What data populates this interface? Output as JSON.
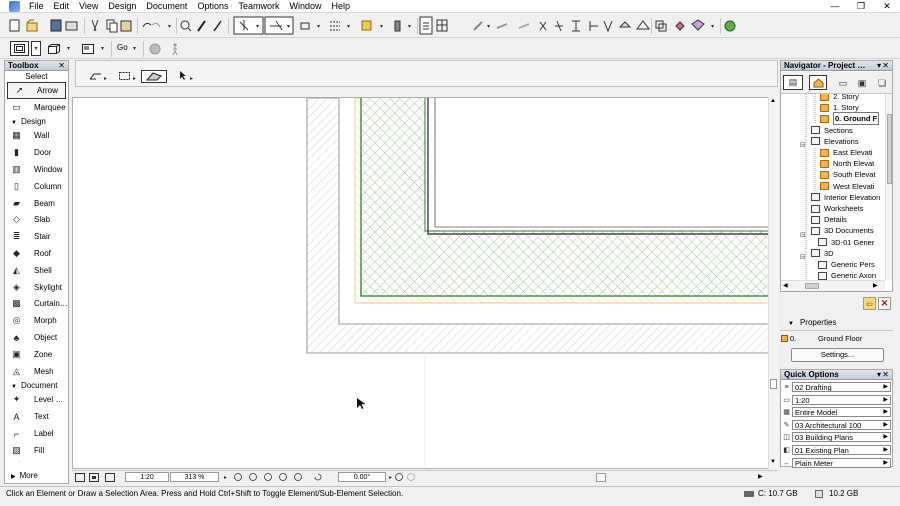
{
  "menubar": {
    "items": [
      "File",
      "Edit",
      "View",
      "Design",
      "Document",
      "Options",
      "Teamwork",
      "Window",
      "Help"
    ]
  },
  "window_controls": {
    "minimize": "—",
    "restore": "❐",
    "close": "✕"
  },
  "toolbar": {
    "go_label": "Go"
  },
  "toolbox": {
    "title": "Toolbox",
    "select_label": "Select",
    "select_tools": [
      {
        "label": "Arrow",
        "icon": "arrow-pointer-icon"
      },
      {
        "label": "Marquee",
        "icon": "marquee-icon"
      }
    ],
    "design_group": "Design",
    "design_tools": [
      {
        "label": "Wall",
        "icon": "wall-icon"
      },
      {
        "label": "Door",
        "icon": "door-icon"
      },
      {
        "label": "Window",
        "icon": "window-icon"
      },
      {
        "label": "Column",
        "icon": "column-icon"
      },
      {
        "label": "Beam",
        "icon": "beam-icon"
      },
      {
        "label": "Slab",
        "icon": "slab-icon"
      },
      {
        "label": "Stair",
        "icon": "stair-icon"
      },
      {
        "label": "Roof",
        "icon": "roof-icon"
      },
      {
        "label": "Shell",
        "icon": "shell-icon"
      },
      {
        "label": "Skylight",
        "icon": "skylight-icon"
      },
      {
        "label": "Curtain…",
        "icon": "curtain-wall-icon"
      },
      {
        "label": "Morph",
        "icon": "morph-icon"
      },
      {
        "label": "Object",
        "icon": "object-icon"
      },
      {
        "label": "Zone",
        "icon": "zone-icon"
      },
      {
        "label": "Mesh",
        "icon": "mesh-icon"
      }
    ],
    "document_group": "Document",
    "document_tools": [
      {
        "label": "Level …",
        "icon": "level-dimension-icon"
      },
      {
        "label": "Text",
        "icon": "text-icon"
      },
      {
        "label": "Label",
        "icon": "label-icon"
      },
      {
        "label": "Fill",
        "icon": "fill-icon"
      },
      {
        "label": "Line",
        "icon": "line-icon"
      }
    ],
    "more_label": "More"
  },
  "bottom_bar": {
    "scale": "1:20",
    "zoom": "313 %",
    "angle": "0.00°"
  },
  "status": {
    "message": "Click an Element or Draw a Selection Area. Press and Hold Ctrl+Shift to Toggle Element/Sub-Element Selection.",
    "disk_c": "C: 10.7 GB",
    "memory": "10.2 GB"
  },
  "navigator": {
    "title": "Navigator - Project …",
    "items": [
      {
        "label": "2. Story",
        "indent": 3,
        "icon": "house",
        "bold": false
      },
      {
        "label": "1. Story",
        "indent": 3,
        "icon": "house",
        "bold": false
      },
      {
        "label": "0. Ground F",
        "indent": 3,
        "icon": "house",
        "bold": true
      },
      {
        "label": "Sections",
        "indent": 1,
        "icon": "doc",
        "bold": false
      },
      {
        "label": "Elevations",
        "indent": 1,
        "icon": "doc",
        "bold": false
      },
      {
        "label": "East Elevati",
        "indent": 3,
        "icon": "house",
        "bold": false
      },
      {
        "label": "North Elevat",
        "indent": 3,
        "icon": "house",
        "bold": false
      },
      {
        "label": "South Elevat",
        "indent": 3,
        "icon": "house",
        "bold": false
      },
      {
        "label": "West Elevati",
        "indent": 3,
        "icon": "house",
        "bold": false
      },
      {
        "label": "Interior Elevation",
        "indent": 1,
        "icon": "doc",
        "bold": false
      },
      {
        "label": "Worksheets",
        "indent": 1,
        "icon": "doc",
        "bold": false
      },
      {
        "label": "Details",
        "indent": 1,
        "icon": "doc",
        "bold": false
      },
      {
        "label": "3D Documents",
        "indent": 1,
        "icon": "doc",
        "bold": false
      },
      {
        "label": "3D-01 Gener",
        "indent": 2,
        "icon": "doc",
        "bold": false
      },
      {
        "label": "3D",
        "indent": 1,
        "icon": "doc",
        "bold": false
      },
      {
        "label": "Generic Pers",
        "indent": 2,
        "icon": "doc",
        "bold": false
      },
      {
        "label": "Generic Axon",
        "indent": 2,
        "icon": "doc",
        "bold": false
      }
    ]
  },
  "properties": {
    "title": "Properties",
    "story_index": "0.",
    "story_name": "Ground Floor",
    "settings_button": "Settings..."
  },
  "quick_options": {
    "title": "Quick Options",
    "rows": [
      {
        "value": "02 Drafting",
        "icon": "layer-icon"
      },
      {
        "value": "1:20",
        "icon": "scale-icon"
      },
      {
        "value": "Entire Model",
        "icon": "structure-icon"
      },
      {
        "value": "03 Architectural 100",
        "icon": "pen-set-icon"
      },
      {
        "value": "03 Building Plans",
        "icon": "model-view-icon"
      },
      {
        "value": "01 Existing Plan",
        "icon": "renovation-icon"
      },
      {
        "value": "Plain Meter",
        "icon": "dimension-icon"
      }
    ]
  }
}
